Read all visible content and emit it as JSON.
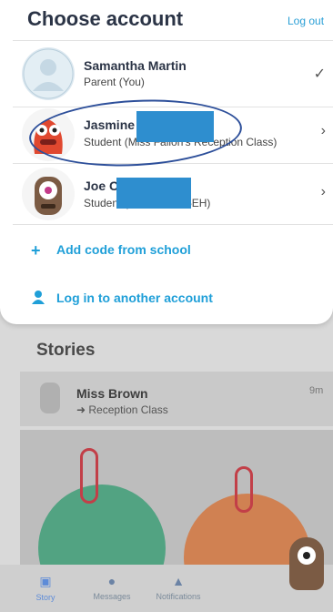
{
  "sheet": {
    "title": "Choose account",
    "logout_label": "Log out",
    "accounts": [
      {
        "name": "Samantha Martin",
        "subtitle": "Parent (You)",
        "indicator": "✓"
      },
      {
        "name": "Jasmine",
        "subtitle": "Student (Miss Fallon's Reception Class)",
        "indicator": "›"
      },
      {
        "name": "Joe C",
        "subtitle": "Student (... 5AR and 5EH)",
        "indicator": "›"
      }
    ],
    "actions": [
      {
        "icon": "plus-icon",
        "label": "Add code from school"
      },
      {
        "icon": "person-icon",
        "label": "Log in to another account"
      }
    ]
  },
  "background": {
    "stories_title": "Stories",
    "story": {
      "author": "Miss Brown",
      "class_label": "Reception Class",
      "time": "9m"
    },
    "nav": [
      {
        "label": "Story",
        "icon": "image-icon",
        "active": true
      },
      {
        "label": "Messages",
        "icon": "chat-icon",
        "active": false
      },
      {
        "label": "Notifications",
        "icon": "bell-icon",
        "active": false
      }
    ]
  },
  "colors": {
    "accent": "#1f9fd8",
    "title": "#2b3446",
    "redaction": "#2e8ecf",
    "annotation": "#2d4f9a"
  }
}
